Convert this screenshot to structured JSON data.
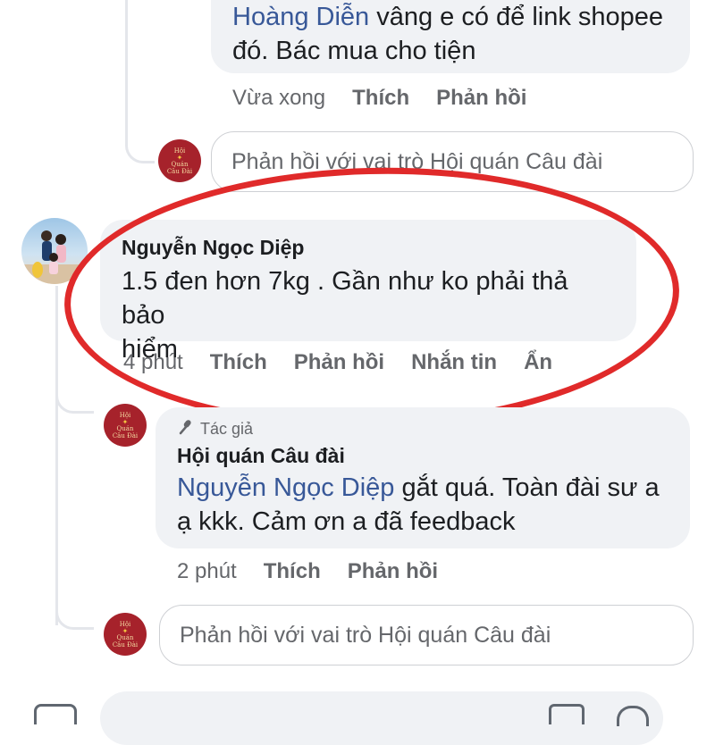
{
  "comments": [
    {
      "mention": "Hoàng Diễn",
      "text_line1": " vâng e có để link shopee",
      "text_line2": "đó. Bác mua cho tiện",
      "time": "Vừa xong",
      "like": "Thích",
      "reply": "Phản hồi"
    },
    {
      "author": "Nguyễn Ngọc Diệp",
      "text_line1": "1.5 đen hơn 7kg . Gần như ko phải thả bảo",
      "text_line2": "hiểm",
      "time": "4 phút",
      "like": "Thích",
      "reply": "Phản hồi",
      "message": "Nhắn tin",
      "hide": "Ẩn"
    },
    {
      "author_tag": "Tác giả",
      "author": "Hội quán Câu đài",
      "mention": "Nguyễn Ngọc Diệp",
      "text_line1": " gắt quá. Toàn đài sư a",
      "text_line2": "ạ kkk. Cảm ơn a đã feedback",
      "time": "2 phút",
      "like": "Thích",
      "reply": "Phản hồi"
    }
  ],
  "reply_inputs": {
    "top_placeholder": "Phản hồi với vai trò Hội quán Câu đài",
    "bottom_placeholder": "Phản hồi với vai trò Hội quán Câu đài"
  },
  "page_avatar": {
    "line1": "Hội",
    "line2": "Quán",
    "line3": "Câu Đài"
  },
  "icons": {
    "camera": "camera-icon",
    "mic": "microphone-icon",
    "sticker": "sticker-icon"
  },
  "colors": {
    "mention": "#385898",
    "highlight": "#e02a2a",
    "bubble": "#f0f2f5"
  }
}
